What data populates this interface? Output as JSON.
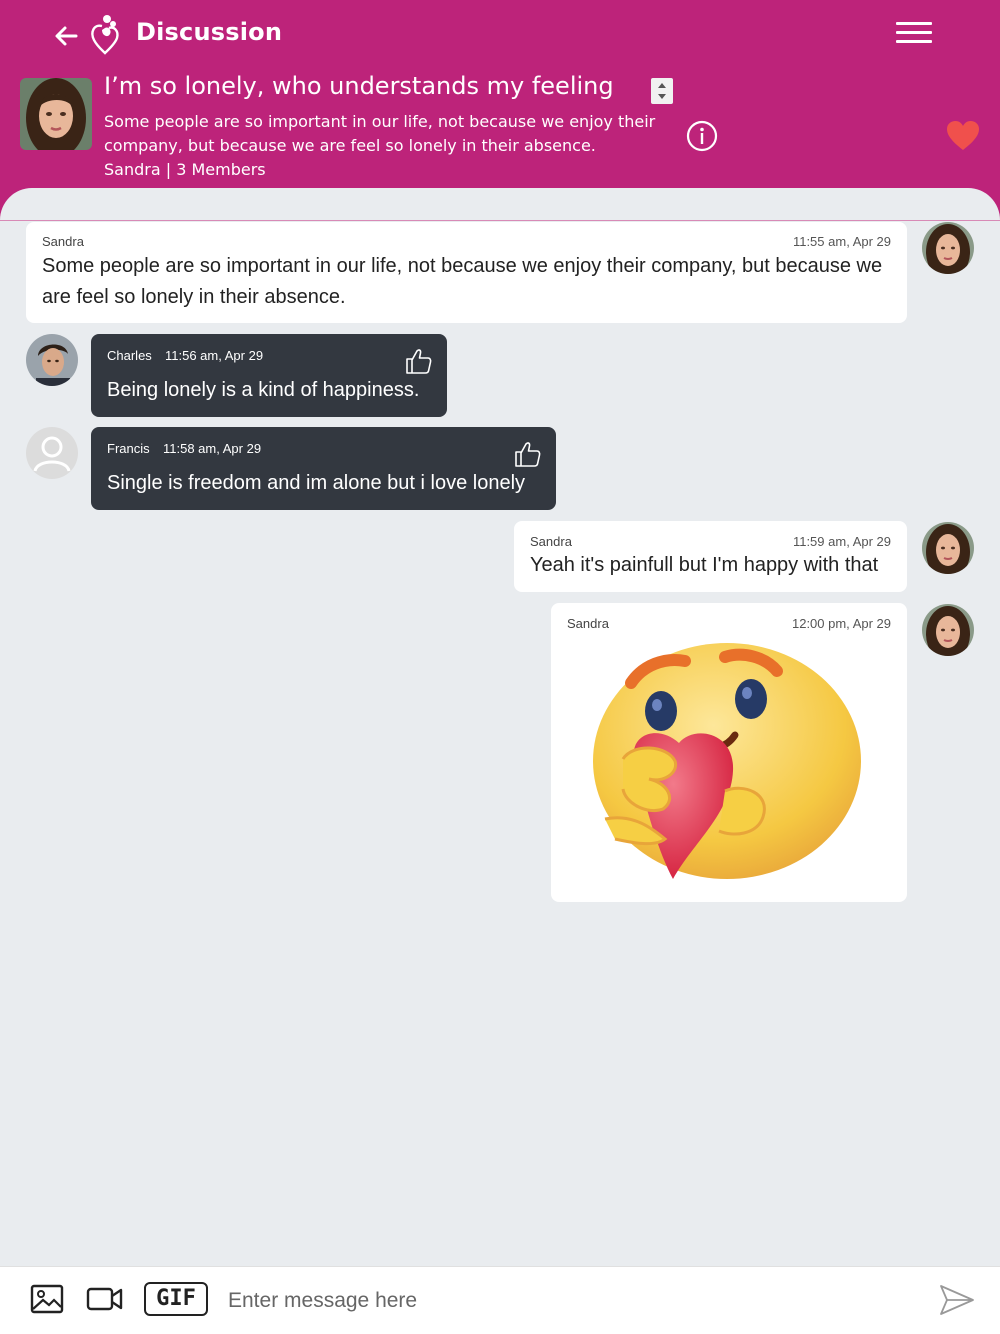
{
  "header": {
    "title": "Discussion",
    "group_title": "I’m so lonely, who understands my feeling",
    "group_description": "Some people are so important in our life, not because we enjoy their company, but because we are feel so lonely in their absence.",
    "group_meta": "Sandra | 3 Members"
  },
  "messages": [
    {
      "author": "Sandra",
      "time": "11:55 am, Apr 29",
      "text": "Some people are so important in our life, not because we enjoy their company, but because we are feel so lonely in their absence."
    },
    {
      "author": "Charles",
      "time": "11:56 am, Apr 29",
      "text": "Being lonely is a kind of happiness."
    },
    {
      "author": "Francis",
      "time": "11:58 am, Apr 29",
      "text": "Single is freedom and im alone but i love lonely"
    },
    {
      "author": "Sandra",
      "time": "11:59 am, Apr 29",
      "text": "Yeah it's painfull but I'm happy with that"
    },
    {
      "author": "Sandra",
      "time": "12:00 pm, Apr 29",
      "sticker": "hug-heart-emoji"
    }
  ],
  "composer": {
    "gif_label": "GIF",
    "placeholder": "Enter message here"
  },
  "colors": {
    "brand": "#bd237a",
    "dark_bubble": "#333840",
    "background": "#e9ecef",
    "heart": "#f0504c"
  }
}
